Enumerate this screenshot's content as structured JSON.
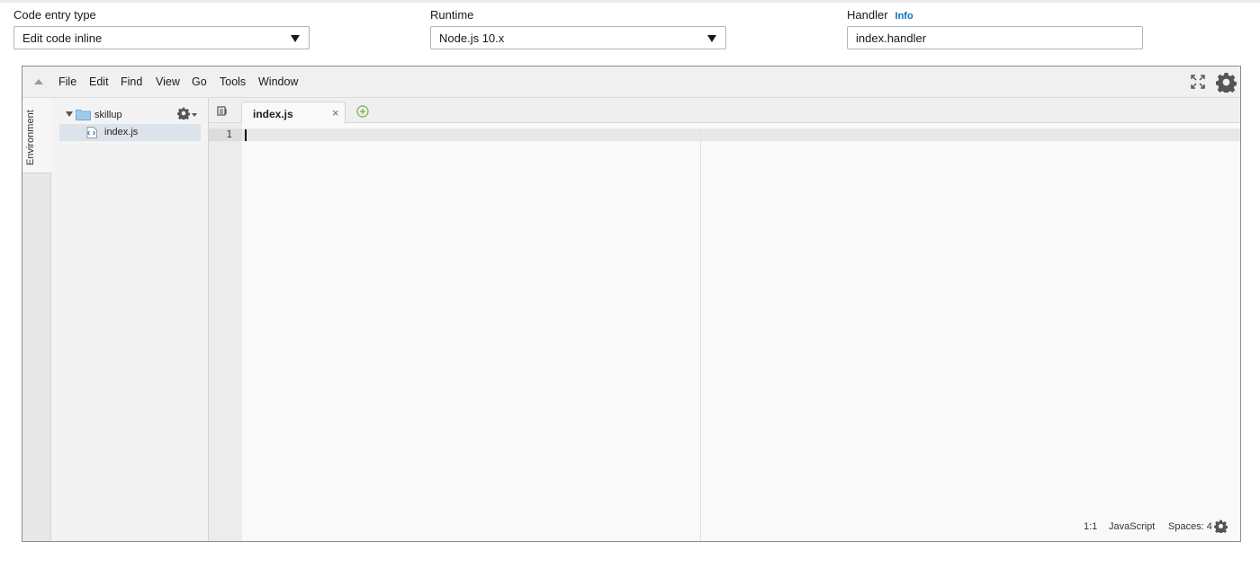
{
  "config": {
    "code_entry": {
      "label": "Code entry type",
      "value": "Edit code inline"
    },
    "runtime": {
      "label": "Runtime",
      "value": "Node.js 10.x"
    },
    "handler": {
      "label": "Handler",
      "info_link": "Info",
      "value": "index.handler"
    }
  },
  "ide": {
    "menu": [
      "File",
      "Edit",
      "Find",
      "View",
      "Go",
      "Tools",
      "Window"
    ],
    "sidebar_tab": "Environment",
    "tree": {
      "folder": "skillup",
      "file": "index.js"
    },
    "tabs": [
      {
        "label": "index.js",
        "close": "×"
      }
    ],
    "editor": {
      "line_numbers": [
        "1"
      ]
    },
    "status": {
      "position": "1:1",
      "language": "JavaScript",
      "indent": "Spaces: 4"
    },
    "icons": [
      "fullscreen-icon",
      "settings-gear-icon",
      "tree-gear-icon",
      "tab-list-icon",
      "add-tab-icon",
      "folder-icon",
      "js-file-icon",
      "status-gear-icon"
    ]
  },
  "colors": {
    "accent_link": "#0073bb",
    "add_tab_green": "#6cb33f",
    "folder_blue": "#9fcbeb"
  }
}
